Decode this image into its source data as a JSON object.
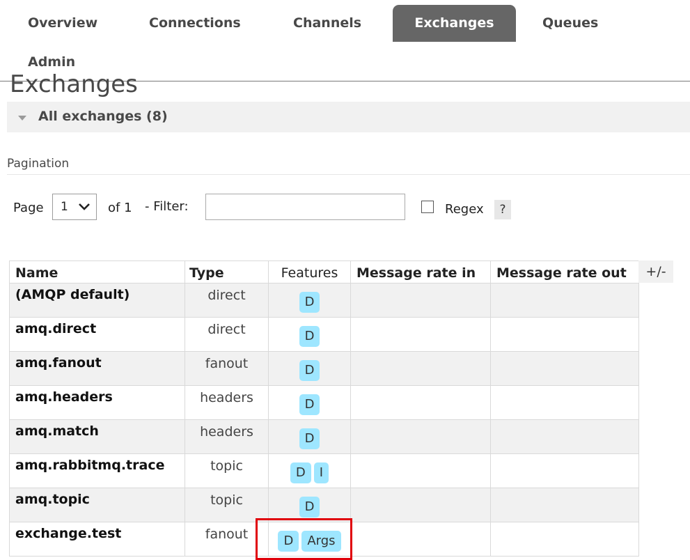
{
  "nav": {
    "tabs": [
      {
        "label": "Overview"
      },
      {
        "label": "Connections"
      },
      {
        "label": "Channels"
      },
      {
        "label": "Exchanges",
        "active": true
      },
      {
        "label": "Queues"
      },
      {
        "label": "Admin"
      }
    ]
  },
  "page": {
    "title": "Exchanges",
    "section_title": "All exchanges (8)",
    "pagination_label": "Pagination"
  },
  "controls": {
    "page_label": "Page",
    "page_value": "1",
    "of_label": "of 1",
    "filter_label": "- Filter:",
    "filter_value": "",
    "regex_label": "Regex",
    "regex_checked": false,
    "help_label": "?"
  },
  "table": {
    "headers": {
      "name": "Name",
      "type": "Type",
      "features": "Features",
      "rate_in": "Message rate in",
      "rate_out": "Message rate out"
    },
    "column_toggle": "+/-",
    "rows": [
      {
        "name": "(AMQP default)",
        "type": "direct",
        "features": [
          "D"
        ]
      },
      {
        "name": "amq.direct",
        "type": "direct",
        "features": [
          "D"
        ]
      },
      {
        "name": "amq.fanout",
        "type": "fanout",
        "features": [
          "D"
        ]
      },
      {
        "name": "amq.headers",
        "type": "headers",
        "features": [
          "D"
        ]
      },
      {
        "name": "amq.match",
        "type": "headers",
        "features": [
          "D"
        ]
      },
      {
        "name": "amq.rabbitmq.trace",
        "type": "topic",
        "features": [
          "D",
          "I"
        ]
      },
      {
        "name": "amq.topic",
        "type": "topic",
        "features": [
          "D"
        ]
      },
      {
        "name": "exchange.test",
        "type": "fanout",
        "features": [
          "D",
          "Args"
        ]
      }
    ]
  },
  "colors": {
    "active_tab_bg": "#666666",
    "badge_bg": "#9ee6ff",
    "highlight_border": "#e0000a",
    "row_alt_bg": "#f1f1f1"
  }
}
